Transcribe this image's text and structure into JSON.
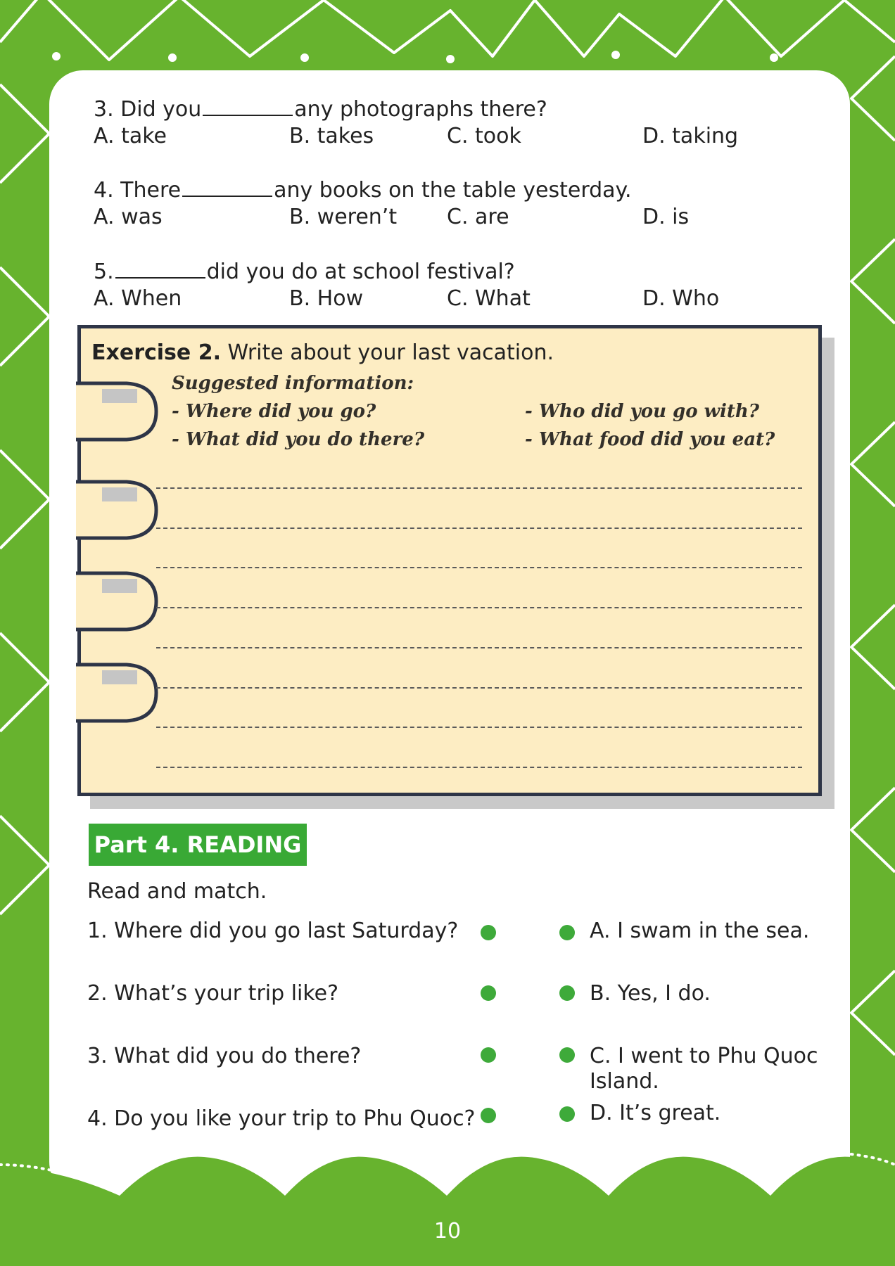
{
  "questions": [
    {
      "pre": "3. Did you",
      "post": "any photographs there?",
      "options": [
        "A. take",
        "B. takes",
        "C. took",
        "D. taking"
      ]
    },
    {
      "pre": "4. There",
      "post": "any books on the table yesterday.",
      "options": [
        "A. was",
        "B. weren’t",
        "C. are",
        "D. is"
      ]
    },
    {
      "pre": "5.",
      "post": "did you do at school festival?",
      "options": [
        "A. When",
        "B. How",
        "C. What",
        "D. Who"
      ]
    }
  ],
  "exercise2": {
    "label": "Exercise 2.",
    "instruction": "Write about your last vacation.",
    "suggested_title": "Suggested information:",
    "suggestions": [
      "- Where did you go?",
      "- What did you do there?",
      "- Who did you go with?",
      "- What food did you eat?"
    ]
  },
  "reading": {
    "part_title": "Part 4. READING",
    "instruction": "Read and match.",
    "questions": [
      "1. Where did you go last Saturday?",
      "2. What’s your trip like?",
      "3. What did you do there?",
      "4. Do you like your trip to Phu Quoc?"
    ],
    "answers": [
      "A. I swam in the sea.",
      "B. Yes, I do.",
      "C. I went to Phu Quoc Island.",
      "D. It’s great."
    ]
  },
  "page_number": "10",
  "colors": {
    "background_green": "#67b32e",
    "note_fill": "#fdedc3",
    "part_badge": "#39a935",
    "dot_green": "#3eaa3a"
  }
}
